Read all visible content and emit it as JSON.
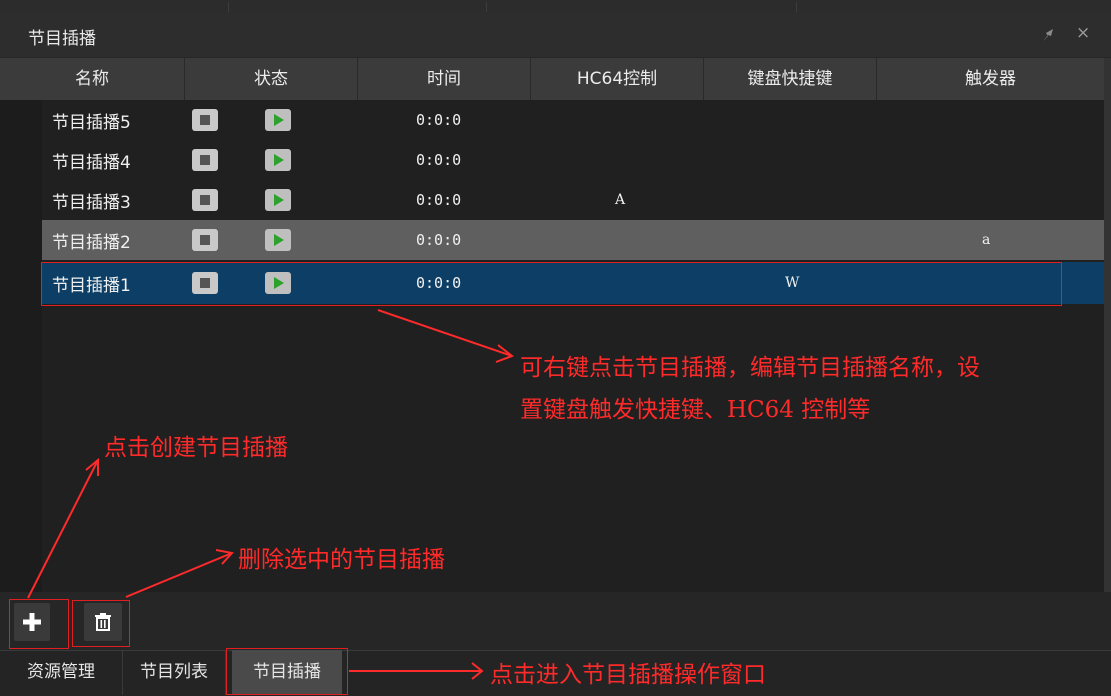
{
  "panel": {
    "title": "节目插播"
  },
  "columns": [
    "名称",
    "状态",
    "时间",
    "HC64控制",
    "键盘快捷键",
    "触发器"
  ],
  "rows": [
    {
      "name": "节目插播5",
      "time": "0:0:0",
      "hc64": "",
      "hotkey": "",
      "trigger": ""
    },
    {
      "name": "节目插播4",
      "time": "0:0:0",
      "hc64": "",
      "hotkey": "",
      "trigger": ""
    },
    {
      "name": "节目插播3",
      "time": "0:0:0",
      "hc64": "A",
      "hotkey": "",
      "trigger": ""
    },
    {
      "name": "节目插播2",
      "time": "0:0:0",
      "hc64": "",
      "hotkey": "",
      "trigger": "a"
    },
    {
      "name": "节目插播1",
      "time": "0:0:0",
      "hc64": "",
      "hotkey": "W",
      "trigger": ""
    }
  ],
  "selected_row": "节目插播1",
  "tabs": [
    "资源管理",
    "节目列表",
    "节目插播"
  ],
  "active_tab": "节目插播",
  "annotations": {
    "edit_line1": "可右键点击节目插播，编辑节目插播名称，设",
    "edit_line2": "置键盘触发快捷键、HC64 控制等",
    "create": "点击创建节目插播",
    "delete": "删除选中的节目插播",
    "tab": "点击进入节目插播操作窗口"
  },
  "colors": {
    "background": "#262626",
    "header": "#3b3b3b",
    "selected_row": "#0d3f66",
    "highlight_row": "#5f5f5f",
    "annotation": "#ff2a2a",
    "play_icon": "#2ca12c"
  },
  "icons": [
    "pin-icon",
    "close-icon",
    "stop-icon",
    "play-icon",
    "plus-icon",
    "trash-icon"
  ]
}
